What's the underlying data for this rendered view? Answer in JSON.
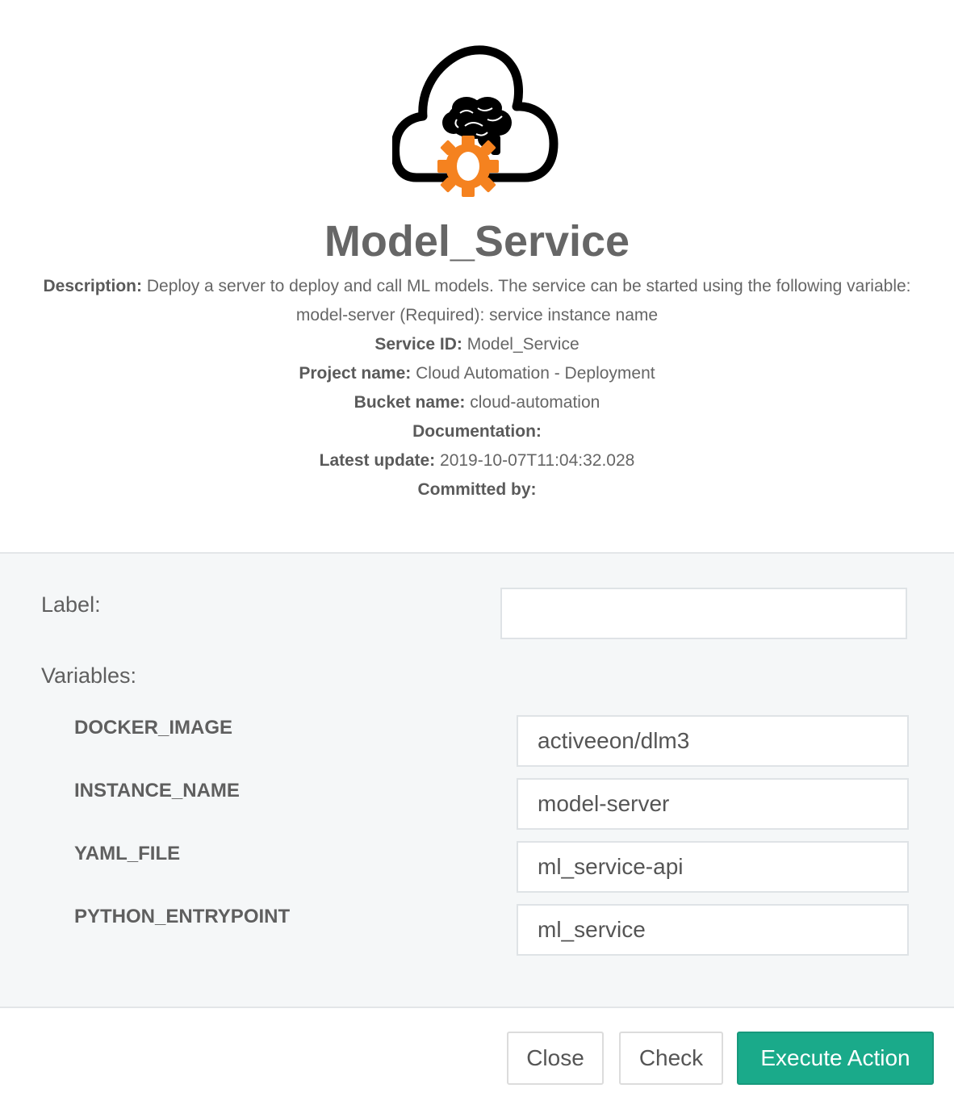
{
  "service": {
    "title": "Model_Service",
    "description_label": "Description:",
    "description": "Deploy a server to deploy and call ML models. The service can be started using the following variable: model-server (Required): service instance name",
    "service_id_label": "Service ID:",
    "service_id": "Model_Service",
    "project_label": "Project name:",
    "project": "Cloud Automation - Deployment",
    "bucket_label": "Bucket name:",
    "bucket": "cloud-automation",
    "documentation_label": "Documentation:",
    "documentation": "",
    "update_label": "Latest update:",
    "update": "2019-10-07T11:04:32.028",
    "committed_label": "Committed by:",
    "committed": ""
  },
  "logo": {
    "icon": "cloud-brain-gear-icon",
    "accent": "#f5821f",
    "outline": "#000000"
  },
  "form": {
    "label_title": "Label:",
    "label_value": "",
    "variables_title": "Variables:",
    "variables": [
      {
        "name": "DOCKER_IMAGE",
        "value": "activeeon/dlm3"
      },
      {
        "name": "INSTANCE_NAME",
        "value": "model-server"
      },
      {
        "name": "YAML_FILE",
        "value": "ml_service-api"
      },
      {
        "name": "PYTHON_ENTRYPOINT",
        "value": "ml_service"
      }
    ]
  },
  "footer": {
    "close_label": "Close",
    "check_label": "Check",
    "execute_label": "Execute Action"
  },
  "colors": {
    "primary": "#1aaa8a",
    "panel_bg": "#f5f7f8"
  }
}
